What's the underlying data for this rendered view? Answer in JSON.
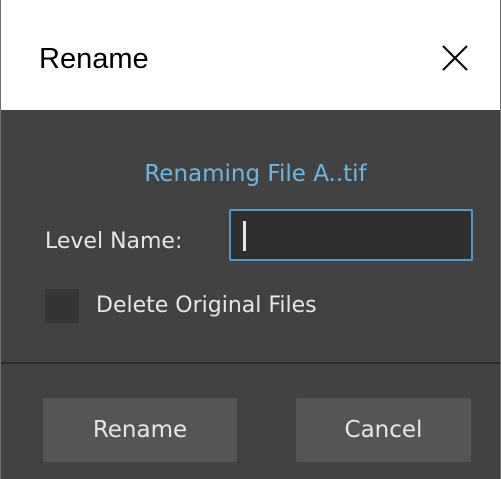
{
  "window": {
    "title": "Rename",
    "close_icon": "close-icon"
  },
  "dialog": {
    "status_text": "Renaming File A..tif",
    "level_name_label": "Level Name:",
    "level_name_value": "",
    "delete_original_label": "Delete Original Files",
    "delete_original_checked": false
  },
  "buttons": {
    "rename_label": "Rename",
    "cancel_label": "Cancel"
  },
  "colors": {
    "content_bg": "#424242",
    "status_text": "#6cb6e6",
    "input_border": "#4e9ad0",
    "button_bg": "#555555",
    "text": "#e6e6e6"
  }
}
